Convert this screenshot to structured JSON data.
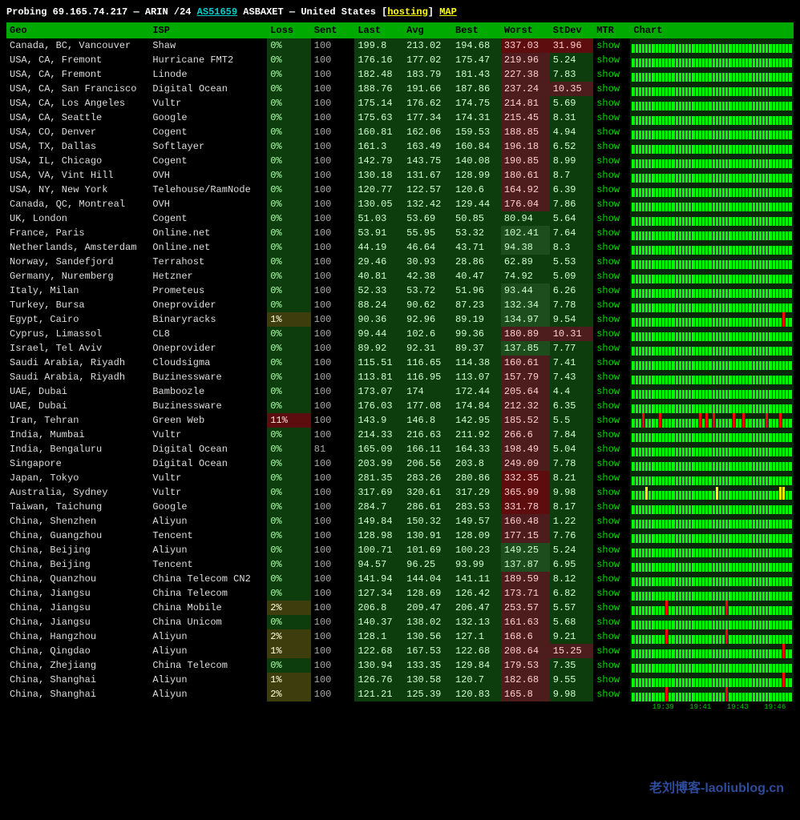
{
  "header": {
    "prefix": "Probing",
    "ip": "69.165.74.217",
    "dash": "—",
    "registry": "ARIN /24",
    "asn": "AS51659",
    "asname": "ASBAXET",
    "dash2": "—",
    "country": "United States",
    "tag": "hosting",
    "map": "MAP"
  },
  "columns": {
    "geo": "Geo",
    "isp": "ISP",
    "loss": "Loss",
    "sent": "Sent",
    "last": "Last",
    "avg": "Avg",
    "best": "Best",
    "worst": "Worst",
    "stdev": "StDev",
    "mtr": "MTR",
    "chart": "Chart"
  },
  "show_label": "show",
  "rows": [
    {
      "geo": "Canada, BC, Vancouver",
      "isp": "Shaw",
      "loss": "0%",
      "sent": "100",
      "last": "199.8",
      "avg": "213.02",
      "best": "194.68",
      "worst": "337.03",
      "stdev": "31.96",
      "lossc": "0",
      "wc": "r2",
      "sc": "r2",
      "chart": "clean"
    },
    {
      "geo": "USA, CA, Fremont",
      "isp": "Hurricane FMT2",
      "loss": "0%",
      "sent": "100",
      "last": "176.16",
      "avg": "177.02",
      "best": "175.47",
      "worst": "219.96",
      "stdev": "5.24",
      "lossc": "0",
      "wc": "r1",
      "sc": "g1",
      "chart": "clean"
    },
    {
      "geo": "USA, CA, Fremont",
      "isp": "Linode",
      "loss": "0%",
      "sent": "100",
      "last": "182.48",
      "avg": "183.79",
      "best": "181.43",
      "worst": "227.38",
      "stdev": "7.83",
      "lossc": "0",
      "wc": "r1",
      "sc": "g1",
      "chart": "clean"
    },
    {
      "geo": "USA, CA, San Francisco",
      "isp": "Digital Ocean",
      "loss": "0%",
      "sent": "100",
      "last": "188.76",
      "avg": "191.66",
      "best": "187.86",
      "worst": "237.24",
      "stdev": "10.35",
      "lossc": "0",
      "wc": "r1",
      "sc": "r1",
      "chart": "clean"
    },
    {
      "geo": "USA, CA, Los Angeles",
      "isp": "Vultr",
      "loss": "0%",
      "sent": "100",
      "last": "175.14",
      "avg": "176.62",
      "best": "174.75",
      "worst": "214.81",
      "stdev": "5.69",
      "lossc": "0",
      "wc": "r1",
      "sc": "g1",
      "chart": "clean"
    },
    {
      "geo": "USA, CA, Seattle",
      "isp": "Google",
      "loss": "0%",
      "sent": "100",
      "last": "175.63",
      "avg": "177.34",
      "best": "174.31",
      "worst": "215.45",
      "stdev": "8.31",
      "lossc": "0",
      "wc": "r1",
      "sc": "g1",
      "chart": "clean"
    },
    {
      "geo": "USA, CO, Denver",
      "isp": "Cogent",
      "loss": "0%",
      "sent": "100",
      "last": "160.81",
      "avg": "162.06",
      "best": "159.53",
      "worst": "188.85",
      "stdev": "4.94",
      "lossc": "0",
      "wc": "r1",
      "sc": "g1",
      "chart": "clean"
    },
    {
      "geo": "USA, TX, Dallas",
      "isp": "Softlayer",
      "loss": "0%",
      "sent": "100",
      "last": "161.3",
      "avg": "163.49",
      "best": "160.84",
      "worst": "196.18",
      "stdev": "6.52",
      "lossc": "0",
      "wc": "r1",
      "sc": "g1",
      "chart": "clean"
    },
    {
      "geo": "USA, IL, Chicago",
      "isp": "Cogent",
      "loss": "0%",
      "sent": "100",
      "last": "142.79",
      "avg": "143.75",
      "best": "140.08",
      "worst": "190.85",
      "stdev": "8.99",
      "lossc": "0",
      "wc": "r1",
      "sc": "g1",
      "chart": "clean"
    },
    {
      "geo": "USA, VA, Vint Hill",
      "isp": "OVH",
      "loss": "0%",
      "sent": "100",
      "last": "130.18",
      "avg": "131.67",
      "best": "128.99",
      "worst": "180.61",
      "stdev": "8.7",
      "lossc": "0",
      "wc": "r1",
      "sc": "g1",
      "chart": "clean"
    },
    {
      "geo": "USA, NY, New York",
      "isp": "Telehouse/RamNode",
      "loss": "0%",
      "sent": "100",
      "last": "120.77",
      "avg": "122.57",
      "best": "120.6",
      "worst": "164.92",
      "stdev": "6.39",
      "lossc": "0",
      "wc": "r1",
      "sc": "g1",
      "chart": "clean"
    },
    {
      "geo": "Canada, QC, Montreal",
      "isp": "OVH",
      "loss": "0%",
      "sent": "100",
      "last": "130.05",
      "avg": "132.42",
      "best": "129.44",
      "worst": "176.04",
      "stdev": "7.86",
      "lossc": "0",
      "wc": "r1",
      "sc": "g1",
      "chart": "clean"
    },
    {
      "geo": "UK, London",
      "isp": "Cogent",
      "loss": "0%",
      "sent": "100",
      "last": "51.03",
      "avg": "53.69",
      "best": "50.85",
      "worst": "80.94",
      "stdev": "5.64",
      "lossc": "0",
      "wc": "g1",
      "sc": "g1",
      "chart": "clean"
    },
    {
      "geo": "France, Paris",
      "isp": "Online.net",
      "loss": "0%",
      "sent": "100",
      "last": "53.91",
      "avg": "55.95",
      "best": "53.32",
      "worst": "102.41",
      "stdev": "7.64",
      "lossc": "0",
      "wc": "g2",
      "sc": "g1",
      "chart": "clean"
    },
    {
      "geo": "Netherlands, Amsterdam",
      "isp": "Online.net",
      "loss": "0%",
      "sent": "100",
      "last": "44.19",
      "avg": "46.64",
      "best": "43.71",
      "worst": "94.38",
      "stdev": "8.3",
      "lossc": "0",
      "wc": "g2",
      "sc": "g1",
      "chart": "clean"
    },
    {
      "geo": "Norway, Sandefjord",
      "isp": "Terrahost",
      "loss": "0%",
      "sent": "100",
      "last": "29.46",
      "avg": "30.93",
      "best": "28.86",
      "worst": "62.89",
      "stdev": "5.53",
      "lossc": "0",
      "wc": "g1",
      "sc": "g1",
      "chart": "clean"
    },
    {
      "geo": "Germany, Nuremberg",
      "isp": "Hetzner",
      "loss": "0%",
      "sent": "100",
      "last": "40.81",
      "avg": "42.38",
      "best": "40.47",
      "worst": "74.92",
      "stdev": "5.09",
      "lossc": "0",
      "wc": "g1",
      "sc": "g1",
      "chart": "clean"
    },
    {
      "geo": "Italy, Milan",
      "isp": "Prometeus",
      "loss": "0%",
      "sent": "100",
      "last": "52.33",
      "avg": "53.72",
      "best": "51.96",
      "worst": "93.44",
      "stdev": "6.26",
      "lossc": "0",
      "wc": "g2",
      "sc": "g1",
      "chart": "clean"
    },
    {
      "geo": "Turkey, Bursa",
      "isp": "Oneprovider",
      "loss": "0%",
      "sent": "100",
      "last": "88.24",
      "avg": "90.62",
      "best": "87.23",
      "worst": "132.34",
      "stdev": "7.78",
      "lossc": "0",
      "wc": "g2",
      "sc": "g1",
      "chart": "clean"
    },
    {
      "geo": "Egypt, Cairo",
      "isp": "Binaryracks",
      "loss": "1%",
      "sent": "100",
      "last": "90.36",
      "avg": "92.96",
      "best": "89.19",
      "worst": "134.97",
      "stdev": "9.54",
      "lossc": "low",
      "wc": "g2",
      "sc": "g1",
      "chart": "spike1"
    },
    {
      "geo": "Cyprus, Limassol",
      "isp": "CL8",
      "loss": "0%",
      "sent": "100",
      "last": "99.44",
      "avg": "102.6",
      "best": "99.36",
      "worst": "180.89",
      "stdev": "10.31",
      "lossc": "0",
      "wc": "r1",
      "sc": "r1",
      "chart": "clean"
    },
    {
      "geo": "Israel, Tel Aviv",
      "isp": "Oneprovider",
      "loss": "0%",
      "sent": "100",
      "last": "89.92",
      "avg": "92.31",
      "best": "89.37",
      "worst": "137.85",
      "stdev": "7.77",
      "lossc": "0",
      "wc": "g2",
      "sc": "g1",
      "chart": "clean"
    },
    {
      "geo": "Saudi Arabia, Riyadh",
      "isp": "Cloudsigma",
      "loss": "0%",
      "sent": "100",
      "last": "115.51",
      "avg": "116.65",
      "best": "114.38",
      "worst": "160.61",
      "stdev": "7.41",
      "lossc": "0",
      "wc": "r1",
      "sc": "g1",
      "chart": "clean"
    },
    {
      "geo": "Saudi Arabia, Riyadh",
      "isp": "Buzinessware",
      "loss": "0%",
      "sent": "100",
      "last": "113.81",
      "avg": "116.95",
      "best": "113.07",
      "worst": "157.79",
      "stdev": "7.43",
      "lossc": "0",
      "wc": "r1",
      "sc": "g1",
      "chart": "clean"
    },
    {
      "geo": "UAE, Dubai",
      "isp": "Bamboozle",
      "loss": "0%",
      "sent": "100",
      "last": "173.07",
      "avg": "174",
      "best": "172.44",
      "worst": "205.64",
      "stdev": "4.4",
      "lossc": "0",
      "wc": "r1",
      "sc": "g1",
      "chart": "clean"
    },
    {
      "geo": "UAE, Dubai",
      "isp": "Buzinessware",
      "loss": "0%",
      "sent": "100",
      "last": "176.03",
      "avg": "177.08",
      "best": "174.84",
      "worst": "212.32",
      "stdev": "6.35",
      "lossc": "0",
      "wc": "r1",
      "sc": "g1",
      "chart": "clean"
    },
    {
      "geo": "Iran, Tehran",
      "isp": "Green Web",
      "loss": "11%",
      "sent": "100",
      "last": "143.9",
      "avg": "146.8",
      "best": "142.95",
      "worst": "185.52",
      "stdev": "5.5",
      "lossc": "high",
      "wc": "r1",
      "sc": "g1",
      "chart": "spikes"
    },
    {
      "geo": "India, Mumbai",
      "isp": "Vultr",
      "loss": "0%",
      "sent": "100",
      "last": "214.33",
      "avg": "216.63",
      "best": "211.92",
      "worst": "266.6",
      "stdev": "7.84",
      "lossc": "0",
      "wc": "r1",
      "sc": "g1",
      "chart": "clean"
    },
    {
      "geo": "India, Bengaluru",
      "isp": "Digital Ocean",
      "loss": "0%",
      "sent": "81",
      "last": "165.09",
      "avg": "166.11",
      "best": "164.33",
      "worst": "198.49",
      "stdev": "5.04",
      "lossc": "0",
      "wc": "r1",
      "sc": "g1",
      "chart": "clean"
    },
    {
      "geo": "Singapore",
      "isp": "Digital Ocean",
      "loss": "0%",
      "sent": "100",
      "last": "203.99",
      "avg": "206.56",
      "best": "203.8",
      "worst": "249.09",
      "stdev": "7.78",
      "lossc": "0",
      "wc": "r1",
      "sc": "g1",
      "chart": "clean"
    },
    {
      "geo": "Japan, Tokyo",
      "isp": "Vultr",
      "loss": "0%",
      "sent": "100",
      "last": "281.35",
      "avg": "283.26",
      "best": "280.86",
      "worst": "332.35",
      "stdev": "8.21",
      "lossc": "0",
      "wc": "r2",
      "sc": "g1",
      "chart": "clean"
    },
    {
      "geo": "Australia, Sydney",
      "isp": "Vultr",
      "loss": "0%",
      "sent": "100",
      "last": "317.69",
      "avg": "320.61",
      "best": "317.29",
      "worst": "365.99",
      "stdev": "9.98",
      "lossc": "0",
      "wc": "r2",
      "sc": "g1",
      "chart": "yspikes"
    },
    {
      "geo": "Taiwan, Taichung",
      "isp": "Google",
      "loss": "0%",
      "sent": "100",
      "last": "284.7",
      "avg": "286.61",
      "best": "283.53",
      "worst": "331.78",
      "stdev": "8.17",
      "lossc": "0",
      "wc": "r2",
      "sc": "g1",
      "chart": "clean"
    },
    {
      "geo": "China, Shenzhen",
      "isp": "Aliyun",
      "loss": "0%",
      "sent": "100",
      "last": "149.84",
      "avg": "150.32",
      "best": "149.57",
      "worst": "160.48",
      "stdev": "1.22",
      "lossc": "0",
      "wc": "r1",
      "sc": "g1",
      "chart": "clean"
    },
    {
      "geo": "China, Guangzhou",
      "isp": "Tencent",
      "loss": "0%",
      "sent": "100",
      "last": "128.98",
      "avg": "130.91",
      "best": "128.09",
      "worst": "177.15",
      "stdev": "7.76",
      "lossc": "0",
      "wc": "r1",
      "sc": "g1",
      "chart": "clean"
    },
    {
      "geo": "China, Beijing",
      "isp": "Aliyun",
      "loss": "0%",
      "sent": "100",
      "last": "100.71",
      "avg": "101.69",
      "best": "100.23",
      "worst": "149.25",
      "stdev": "5.24",
      "lossc": "0",
      "wc": "g2",
      "sc": "g1",
      "chart": "clean"
    },
    {
      "geo": "China, Beijing",
      "isp": "Tencent",
      "loss": "0%",
      "sent": "100",
      "last": "94.57",
      "avg": "96.25",
      "best": "93.99",
      "worst": "137.87",
      "stdev": "6.95",
      "lossc": "0",
      "wc": "g2",
      "sc": "g1",
      "chart": "clean"
    },
    {
      "geo": "China, Quanzhou",
      "isp": "China Telecom CN2",
      "loss": "0%",
      "sent": "100",
      "last": "141.94",
      "avg": "144.04",
      "best": "141.11",
      "worst": "189.59",
      "stdev": "8.12",
      "lossc": "0",
      "wc": "r1",
      "sc": "g1",
      "chart": "clean"
    },
    {
      "geo": "China, Jiangsu",
      "isp": "China Telecom",
      "loss": "0%",
      "sent": "100",
      "last": "127.34",
      "avg": "128.69",
      "best": "126.42",
      "worst": "173.71",
      "stdev": "6.82",
      "lossc": "0",
      "wc": "r1",
      "sc": "g1",
      "chart": "clean"
    },
    {
      "geo": "China, Jiangsu",
      "isp": "China Mobile",
      "loss": "2%",
      "sent": "100",
      "last": "206.8",
      "avg": "209.47",
      "best": "206.47",
      "worst": "253.57",
      "stdev": "5.57",
      "lossc": "low",
      "wc": "r1",
      "sc": "g1",
      "chart": "spike2"
    },
    {
      "geo": "China, Jiangsu",
      "isp": "China Unicom",
      "loss": "0%",
      "sent": "100",
      "last": "140.37",
      "avg": "138.02",
      "best": "132.13",
      "worst": "161.63",
      "stdev": "5.68",
      "lossc": "0",
      "wc": "r1",
      "sc": "g1",
      "chart": "clean"
    },
    {
      "geo": "China, Hangzhou",
      "isp": "Aliyun",
      "loss": "2%",
      "sent": "100",
      "last": "128.1",
      "avg": "130.56",
      "best": "127.1",
      "worst": "168.6",
      "stdev": "9.21",
      "lossc": "low",
      "wc": "r1",
      "sc": "g1",
      "chart": "spike2"
    },
    {
      "geo": "China, Qingdao",
      "isp": "Aliyun",
      "loss": "1%",
      "sent": "100",
      "last": "122.68",
      "avg": "167.53",
      "best": "122.68",
      "worst": "208.64",
      "stdev": "15.25",
      "lossc": "low",
      "wc": "r1",
      "sc": "r1",
      "chart": "spike1"
    },
    {
      "geo": "China, Zhejiang",
      "isp": "China Telecom",
      "loss": "0%",
      "sent": "100",
      "last": "130.94",
      "avg": "133.35",
      "best": "129.84",
      "worst": "179.53",
      "stdev": "7.35",
      "lossc": "0",
      "wc": "r1",
      "sc": "g1",
      "chart": "clean"
    },
    {
      "geo": "China, Shanghai",
      "isp": "Aliyun",
      "loss": "1%",
      "sent": "100",
      "last": "126.76",
      "avg": "130.58",
      "best": "120.7",
      "worst": "182.68",
      "stdev": "9.55",
      "lossc": "low",
      "wc": "r1",
      "sc": "g1",
      "chart": "spike1"
    },
    {
      "geo": "China, Shanghai",
      "isp": "Aliyun",
      "loss": "2%",
      "sent": "100",
      "last": "121.21",
      "avg": "125.39",
      "best": "120.83",
      "worst": "165.8",
      "stdev": "9.98",
      "lossc": "low",
      "wc": "r1",
      "sc": "g1",
      "chart": "spike2"
    }
  ],
  "timeline": [
    "19:39",
    "19:41",
    "19:43",
    "19:46"
  ],
  "watermark": "老刘博客-laoliublog.cn"
}
